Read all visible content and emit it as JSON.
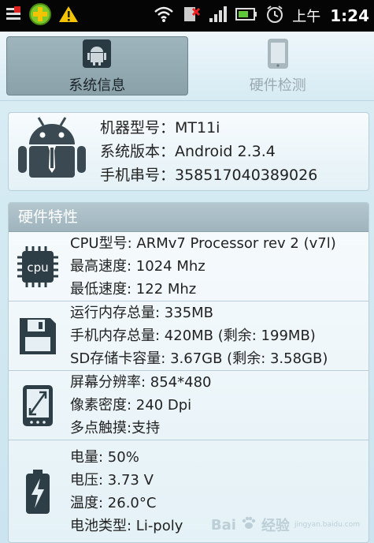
{
  "statusbar": {
    "ampm": "上午",
    "time": "1:24"
  },
  "tabs": [
    {
      "label": "系统信息",
      "active": true
    },
    {
      "label": "硬件检测",
      "active": false
    }
  ],
  "device": {
    "lines": [
      "机器型号：MT11i",
      "系统版本：Android 2.3.4",
      "手机串号：358517040389026"
    ]
  },
  "hardware": {
    "title": "硬件特性",
    "cpu": {
      "icon_label": "cpu",
      "lines": [
        "CPU型号: ARMv7 Processor rev 2 (v7l)",
        "最高速度: 1024 Mhz",
        "最低速度: 122 Mhz"
      ]
    },
    "memory": {
      "lines": [
        "运行内存总量: 335MB",
        "手机内存总量: 420MB (剩余: 199MB)",
        "SD存储卡容量: 3.67GB (剩余: 3.58GB)"
      ]
    },
    "screen": {
      "lines": [
        "屏幕分辨率: 854*480",
        "像素密度: 240 Dpi",
        "多点触摸:支持"
      ]
    },
    "battery": {
      "lines": [
        "电量: 50%",
        "电压: 3.73 V",
        "温度: 26.0°C",
        "电池类型: Li-poly"
      ]
    }
  },
  "watermark": {
    "brand": "Bai",
    "suffix": "经验",
    "url": "jingyan.baidu.com"
  }
}
